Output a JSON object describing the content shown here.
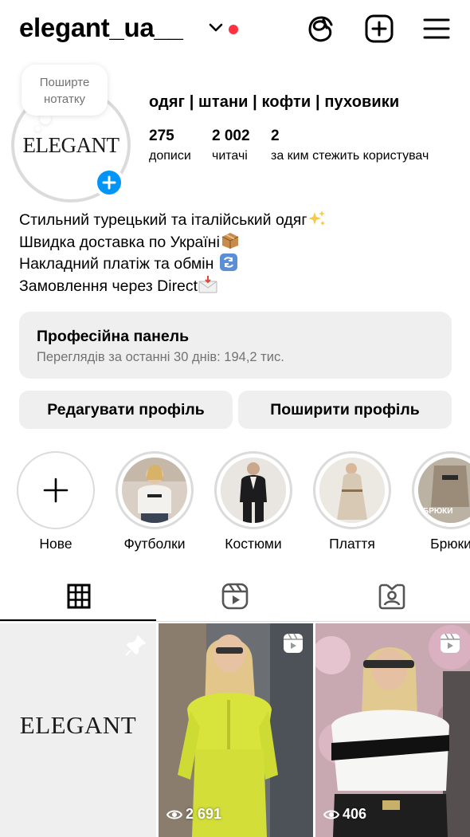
{
  "header": {
    "username": "elegant_ua__",
    "icons": [
      "chevron-down-icon",
      "threads-icon",
      "create-post-icon",
      "menu-icon"
    ],
    "notification_dot_color": "#ff3040"
  },
  "profile": {
    "note_prompt": "Поширте нотатку",
    "avatar_logo_text": "ELEGANT",
    "category": "одяг | штани | кофти | пуховики",
    "stats": [
      {
        "value": "275",
        "label": "дописи"
      },
      {
        "value": "2 002",
        "label": "читачі"
      },
      {
        "value": "2",
        "label": "за ким стежить користувач"
      }
    ],
    "bio": [
      {
        "text": "Стильний турецький та італійський одяг",
        "emoji": "sparkles"
      },
      {
        "text": "Швидка доставка по Україні",
        "emoji": "package"
      },
      {
        "text": "Накладний платіж та обмін ",
        "emoji": "arrows-cycle"
      },
      {
        "text": "Замовлення через Direct",
        "emoji": "envelope-arrow"
      }
    ]
  },
  "pro_panel": {
    "title": "Професійна панель",
    "subtitle": "Переглядів за останні 30 днів: 194,2 тис."
  },
  "buttons": {
    "edit_profile": "Редагувати профіль",
    "share_profile": "Поширити профіль"
  },
  "highlights": [
    {
      "label": "Нове",
      "type": "new"
    },
    {
      "label": "Футболки"
    },
    {
      "label": "Костюми"
    },
    {
      "label": "Плаття"
    },
    {
      "label": "Брюки",
      "cover_text": "брюки"
    }
  ],
  "tabs": [
    {
      "icon": "grid-icon",
      "active": true
    },
    {
      "icon": "reels-icon",
      "active": false
    },
    {
      "icon": "tagged-icon",
      "active": false
    }
  ],
  "posts": [
    {
      "type": "pinned",
      "cover_text": "ELEGANT"
    },
    {
      "type": "reel",
      "views": "2 691"
    },
    {
      "type": "reel",
      "views": "406"
    }
  ],
  "colors": {
    "accent_blue": "#0095f6",
    "panel_gray": "#efefef",
    "secondary_text": "#737373"
  }
}
